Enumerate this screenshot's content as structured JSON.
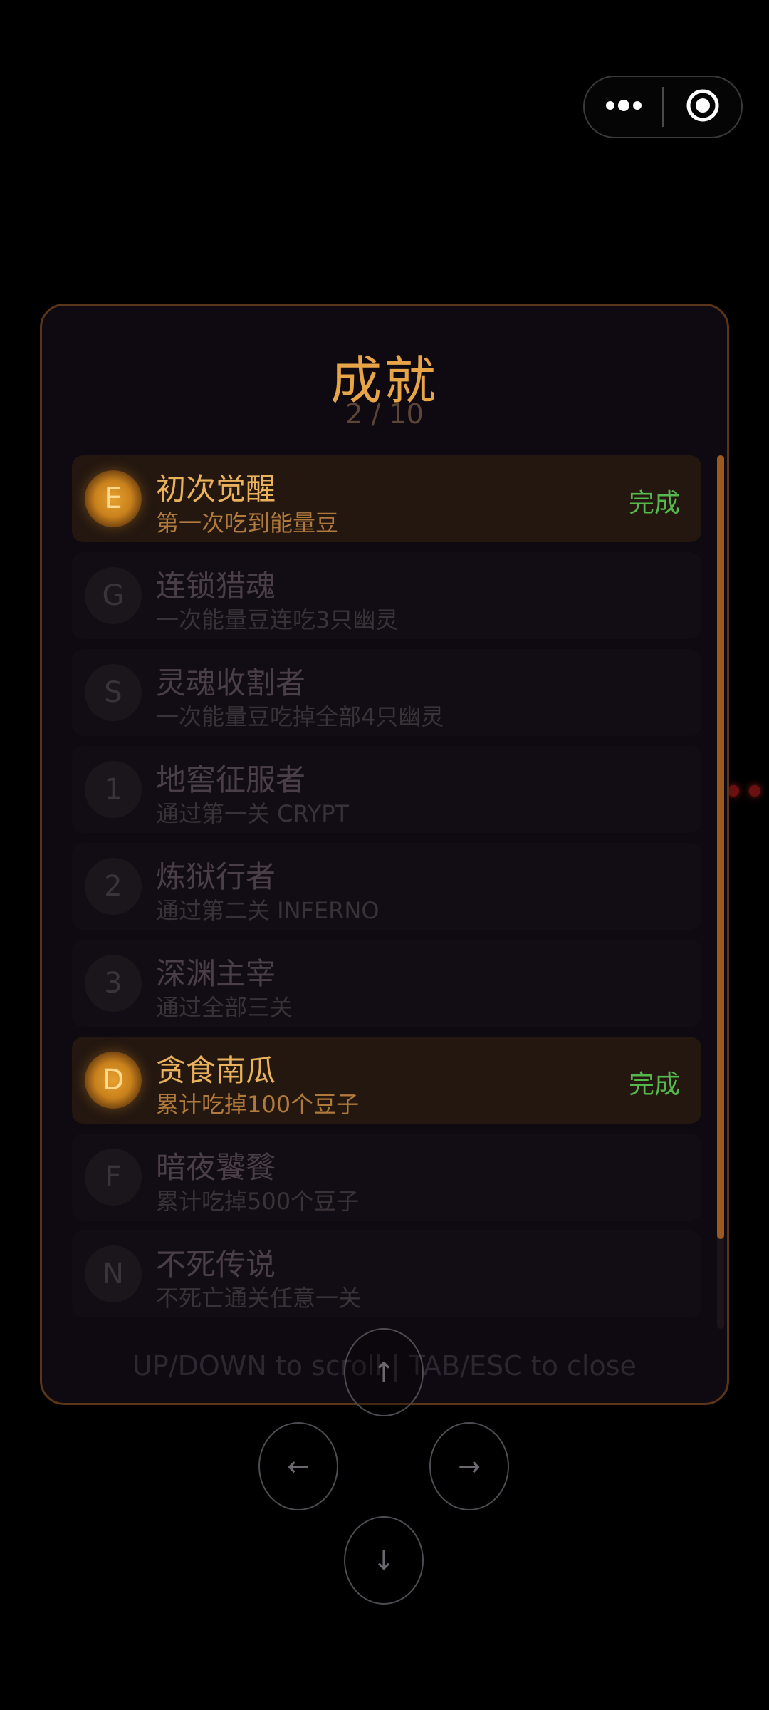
{
  "capsule": {
    "more_icon": "more-dots-icon",
    "close_icon": "target-close-icon"
  },
  "modal": {
    "title": "成就",
    "count": "2 / 10",
    "hint": "UP/DOWN to scroll | TAB/ESC to close"
  },
  "achievements": [
    {
      "badge": "E",
      "title": "初次觉醒",
      "desc": "第一次吃到能量豆",
      "status": "完成",
      "done": true
    },
    {
      "badge": "G",
      "title": "连锁猎魂",
      "desc": "一次能量豆连吃3只幽灵",
      "status": "",
      "done": false
    },
    {
      "badge": "S",
      "title": "灵魂收割者",
      "desc": "一次能量豆吃掉全部4只幽灵",
      "status": "",
      "done": false
    },
    {
      "badge": "1",
      "title": "地窖征服者",
      "desc": "通过第一关 CRYPT",
      "status": "",
      "done": false
    },
    {
      "badge": "2",
      "title": "炼狱行者",
      "desc": "通过第二关 INFERNO",
      "status": "",
      "done": false
    },
    {
      "badge": "3",
      "title": "深渊主宰",
      "desc": "通过全部三关",
      "status": "",
      "done": false
    },
    {
      "badge": "D",
      "title": "贪食南瓜",
      "desc": "累计吃掉100个豆子",
      "status": "完成",
      "done": true
    },
    {
      "badge": "F",
      "title": "暗夜饕餮",
      "desc": "累计吃掉500个豆子",
      "status": "",
      "done": false
    },
    {
      "badge": "N",
      "title": "不死传说",
      "desc": "不死亡通关任意一关",
      "status": "",
      "done": false
    }
  ],
  "controls": {
    "up": "↑",
    "left": "←",
    "right": "→",
    "down": "↓"
  },
  "colors": {
    "accent": "#e8a547",
    "done_green": "#56b84c",
    "modal_border": "#5a3518"
  }
}
